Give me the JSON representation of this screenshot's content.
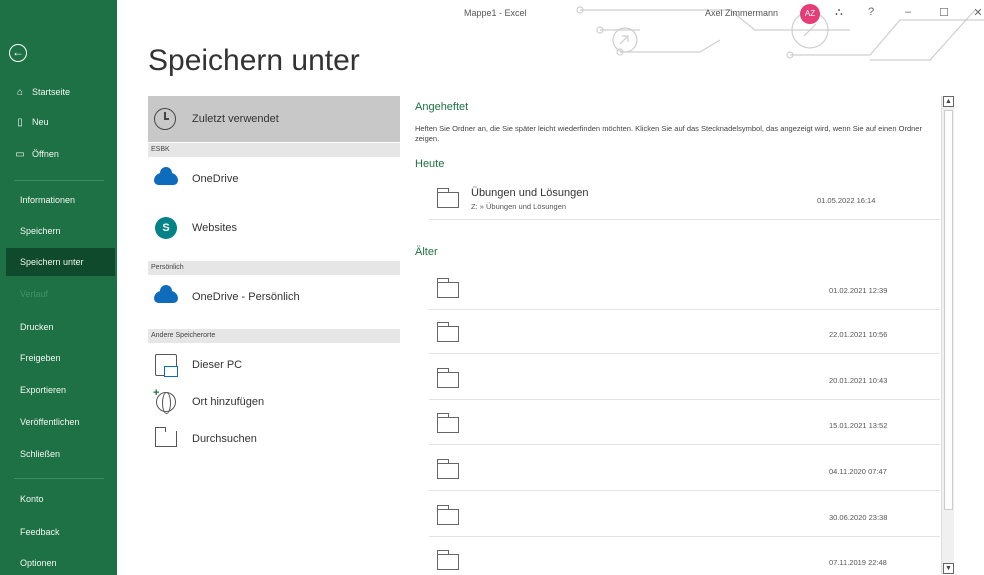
{
  "window": {
    "title": "Mappe1  -  Excel",
    "user": "Axel Zimmermann",
    "avatar_initials": "AZ",
    "minimize": "–",
    "maximize": "☐",
    "close": "✕",
    "help": "?",
    "coauthor": "⛬"
  },
  "nav": {
    "back": "←",
    "top_items": [
      {
        "label": "Startseite",
        "icon": "home-icon"
      },
      {
        "label": "Neu",
        "icon": "new-file-icon"
      },
      {
        "label": "Öffnen",
        "icon": "open-folder-icon"
      }
    ],
    "items": [
      {
        "label": "Informationen"
      },
      {
        "label": "Speichern"
      },
      {
        "label": "Speichern unter"
      },
      {
        "label": "Verlauf"
      },
      {
        "label": "Drucken"
      },
      {
        "label": "Freigeben"
      },
      {
        "label": "Exportieren"
      },
      {
        "label": "Veröffentlichen"
      },
      {
        "label": "Schließen"
      }
    ],
    "bottom_items": [
      {
        "label": "Konto"
      },
      {
        "label": "Feedback"
      },
      {
        "label": "Optionen"
      }
    ],
    "active": "Speichern unter",
    "colors": {
      "background": "#1e7145",
      "active": "#0f4a2c"
    }
  },
  "page": {
    "title": "Speichern unter"
  },
  "locations": {
    "recent": "Zuletzt verwendet",
    "groups": [
      {
        "header": "ESBK",
        "items": [
          "OneDrive",
          "Websites"
        ]
      },
      {
        "header": "Persönlich",
        "items": [
          "OneDrive - Persönlich"
        ]
      },
      {
        "header": "Andere Speicherorte",
        "items": [
          "Dieser PC",
          "Ort hinzufügen",
          "Durchsuchen"
        ]
      }
    ]
  },
  "pinned": {
    "title": "Angeheftet",
    "description": "Heften Sie Ordner an, die Sie später leicht wiederfinden möchten. Klicken Sie auf das Stecknadelsymbol, das angezeigt wird, wenn Sie auf einen Ordner zeigen."
  },
  "today": {
    "title": "Heute",
    "folders": [
      {
        "name": "Übungen und Lösungen",
        "path": "Z: » Übungen und Lösungen",
        "date": "01.05.2022 16:14"
      }
    ]
  },
  "older": {
    "title": "Älter",
    "folders": [
      {
        "name": "",
        "path": "",
        "date": "01.02.2021 12:39"
      },
      {
        "name": "",
        "path": "",
        "date": "22.01.2021 10:56"
      },
      {
        "name": "",
        "path": "",
        "date": "20.01.2021 10:43"
      },
      {
        "name": "",
        "path": "",
        "date": "15.01.2021 13:52"
      },
      {
        "name": "",
        "path": "",
        "date": "04.11.2020 07:47"
      },
      {
        "name": "",
        "path": "",
        "date": "30.06.2020 23:38"
      },
      {
        "name": "",
        "path": "",
        "date": "07.11.2019 22:48"
      }
    ]
  },
  "scrollbar": {
    "up": "▲",
    "down": "▼"
  }
}
